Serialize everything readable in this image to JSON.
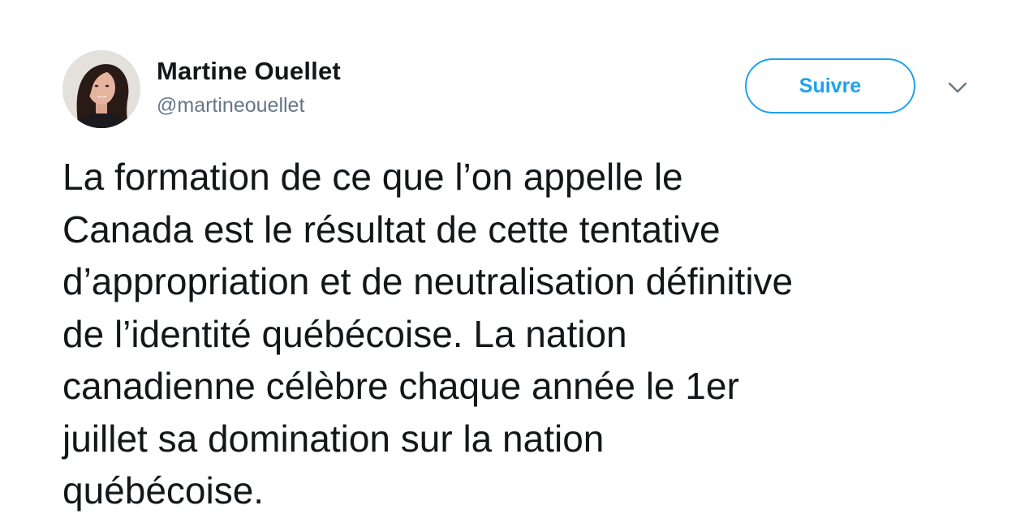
{
  "author": {
    "display_name": "Martine Ouellet",
    "handle": "@martineouellet",
    "avatar_icon": "profile-photo"
  },
  "actions": {
    "follow_label": "Suivre",
    "menu_icon": "chevron-down-icon"
  },
  "tweet": {
    "lines": [
      "La formation de ce que l’on appelle le",
      "Canada est le résultat de cette tentative",
      "d’appropriation et de neutralisation définitive",
      "de l’identité québécoise. La nation",
      "canadienne célèbre chaque année le 1er",
      "juillet sa domination sur la nation",
      "québécoise."
    ]
  },
  "colors": {
    "accent": "#1da1f2",
    "text": "#14171a",
    "secondary": "#657786"
  }
}
